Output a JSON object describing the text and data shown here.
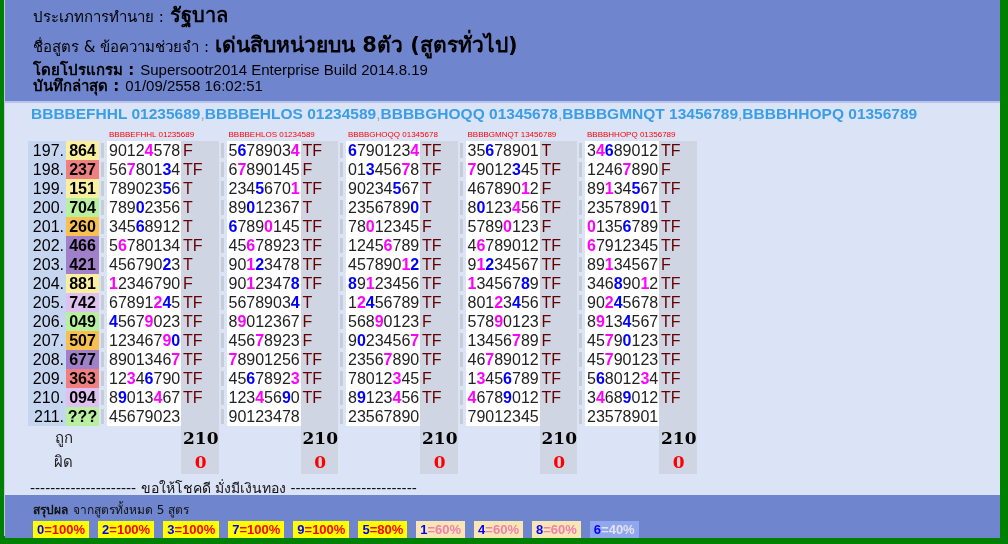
{
  "header": [
    {
      "label": "ประเภทการทำนาย :",
      "value": "รัฐบาล"
    },
    {
      "label": "ชื่อสูตร & ข้อความช่วยจำ :",
      "value": "เด่นสิบหน่วยบน 8ตัว (สูตรทั่วไป)"
    },
    {
      "label": "โดยโปรแกรม :",
      "value": "Supersootr2014 Enterprise Build 2014.8.19"
    },
    {
      "label": "บันทึกล่าสุด :",
      "value": "01/09/2558 16:02:51"
    }
  ],
  "formula_bar": {
    "separator": ",",
    "titles": [
      "BBBBEFHHL 01235689",
      "BBBBEHLOS 01234589",
      "BBBBGHOQQ 01345678",
      "BBBBGMNQT 13456789",
      "BBBBHHOPQ 01356789"
    ]
  },
  "rows": [
    {
      "number": "197.",
      "draw": "864",
      "color": "#f8f0a0"
    },
    {
      "number": "198.",
      "draw": "237",
      "color": "#f08080"
    },
    {
      "number": "199.",
      "draw": "151",
      "color": "#f8f0a0"
    },
    {
      "number": "200.",
      "draw": "704",
      "color": "#b8f0a0"
    },
    {
      "number": "201.",
      "draw": "260",
      "color": "#f8c050"
    },
    {
      "number": "202.",
      "draw": "466",
      "color": "#a080c8"
    },
    {
      "number": "203.",
      "draw": "421",
      "color": "#a080c8"
    },
    {
      "number": "204.",
      "draw": "881",
      "color": "#f8f0a0"
    },
    {
      "number": "205.",
      "draw": "742",
      "color": "#e0c0f0"
    },
    {
      "number": "206.",
      "draw": "049",
      "color": "#b8f0a0"
    },
    {
      "number": "207.",
      "draw": "507",
      "color": "#f8c050"
    },
    {
      "number": "208.",
      "draw": "677",
      "color": "#a080c8"
    },
    {
      "number": "209.",
      "draw": "363",
      "color": "#f08080"
    },
    {
      "number": "210.",
      "draw": "094",
      "color": "#e0c0f0"
    },
    {
      "number": "211.",
      "draw": "???",
      "color": "#b8f0a0"
    }
  ],
  "formulas": [
    {
      "label": "BBBBEFHHL 01235689",
      "correct": "210",
      "wrong": "0",
      "cells": [
        {
          "parts": [
            {
              "text": "9012"
            },
            {
              "text": "4",
              "color": "#ff00ff"
            },
            {
              "text": "578"
            }
          ],
          "result": "F"
        },
        {
          "parts": [
            {
              "text": "56"
            },
            {
              "text": "7",
              "color": "#ff00ff"
            },
            {
              "text": "801"
            },
            {
              "text": "3",
              "color": "#0000ff"
            },
            {
              "text": "4"
            }
          ],
          "result": "TF"
        },
        {
          "parts": [
            {
              "text": "789023"
            },
            {
              "text": "5",
              "color": "#0000ff"
            },
            {
              "text": "6"
            }
          ],
          "result": "T"
        },
        {
          "parts": [
            {
              "text": "789"
            },
            {
              "text": "0",
              "color": "#0000ff"
            },
            {
              "text": "2356"
            }
          ],
          "result": "T"
        },
        {
          "parts": [
            {
              "text": "345"
            },
            {
              "text": "6",
              "color": "#0000ff"
            },
            {
              "text": "8912"
            }
          ],
          "result": "T"
        },
        {
          "parts": [
            {
              "text": "5"
            },
            {
              "text": "6",
              "color": "#ff00ff"
            },
            {
              "text": "780134"
            }
          ],
          "result": "TF"
        },
        {
          "parts": [
            {
              "text": "456790"
            },
            {
              "text": "2",
              "color": "#0000ff"
            },
            {
              "text": "3"
            }
          ],
          "result": "T"
        },
        {
          "parts": [
            {
              "text": "1",
              "color": "#ff00ff"
            },
            {
              "text": "2346790"
            }
          ],
          "result": "F"
        },
        {
          "parts": [
            {
              "text": "67891"
            },
            {
              "text": "2",
              "color": "#ff00ff"
            },
            {
              "text": "4",
              "color": "#0000ff"
            },
            {
              "text": "5"
            }
          ],
          "result": "TF"
        },
        {
          "parts": [
            {
              "text": "4",
              "color": "#0000ff"
            },
            {
              "text": "567"
            },
            {
              "text": "9",
              "color": "#ff00ff"
            },
            {
              "text": "023"
            }
          ],
          "result": "TF"
        },
        {
          "parts": [
            {
              "text": "123467"
            },
            {
              "text": "9",
              "color": "#ff00ff"
            },
            {
              "text": "0",
              "color": "#0000ff"
            }
          ],
          "result": "TF"
        },
        {
          "parts": [
            {
              "text": "8901346"
            },
            {
              "text": "7",
              "color": "#ff00ff"
            }
          ],
          "result": "TF"
        },
        {
          "parts": [
            {
              "text": "12"
            },
            {
              "text": "3",
              "color": "#ff00ff"
            },
            {
              "text": "4"
            },
            {
              "text": "6",
              "color": "#0000ff"
            },
            {
              "text": "790"
            }
          ],
          "result": "TF"
        },
        {
          "parts": [
            {
              "text": "8"
            },
            {
              "text": "9",
              "color": "#0000ff"
            },
            {
              "text": "013"
            },
            {
              "text": "4",
              "color": "#ff00ff"
            },
            {
              "text": "67"
            }
          ],
          "result": "TF"
        },
        {
          "parts": [
            {
              "text": "45679023"
            }
          ]
        }
      ]
    },
    {
      "label": "BBBBEHLOS 01234589",
      "correct": "210",
      "wrong": "0",
      "cells": [
        {
          "parts": [
            {
              "text": "5"
            },
            {
              "text": "6",
              "color": "#0000ff"
            },
            {
              "text": "78903"
            },
            {
              "text": "4",
              "color": "#ff00ff"
            }
          ],
          "result": "TF"
        },
        {
          "parts": [
            {
              "text": "6"
            },
            {
              "text": "7",
              "color": "#ff00ff"
            },
            {
              "text": "890145"
            }
          ],
          "result": "F"
        },
        {
          "parts": [
            {
              "text": "234"
            },
            {
              "text": "5",
              "color": "#0000ff"
            },
            {
              "text": "670"
            },
            {
              "text": "1",
              "color": "#ff00ff"
            }
          ],
          "result": "TF"
        },
        {
          "parts": [
            {
              "text": "89"
            },
            {
              "text": "0",
              "color": "#0000ff"
            },
            {
              "text": "12367"
            }
          ],
          "result": "T"
        },
        {
          "parts": [
            {
              "text": "6",
              "color": "#0000ff"
            },
            {
              "text": "789"
            },
            {
              "text": "0",
              "color": "#ff00ff"
            },
            {
              "text": "145"
            }
          ],
          "result": "TF"
        },
        {
          "parts": [
            {
              "text": "45"
            },
            {
              "text": "6",
              "color": "#ff00ff"
            },
            {
              "text": "78923"
            }
          ],
          "result": "TF"
        },
        {
          "parts": [
            {
              "text": "90"
            },
            {
              "text": "1",
              "color": "#ff00ff"
            },
            {
              "text": "2",
              "color": "#0000ff"
            },
            {
              "text": "3478"
            }
          ],
          "result": "TF"
        },
        {
          "parts": [
            {
              "text": "90"
            },
            {
              "text": "1",
              "color": "#ff00ff"
            },
            {
              "text": "2347"
            },
            {
              "text": "8",
              "color": "#0000ff"
            }
          ],
          "result": "TF"
        },
        {
          "parts": [
            {
              "text": "5678903"
            },
            {
              "text": "4",
              "color": "#0000ff"
            }
          ],
          "result": "T"
        },
        {
          "parts": [
            {
              "text": "8"
            },
            {
              "text": "9",
              "color": "#ff00ff"
            },
            {
              "text": "012367"
            }
          ],
          "result": "F"
        },
        {
          "parts": [
            {
              "text": "456"
            },
            {
              "text": "7",
              "color": "#ff00ff"
            },
            {
              "text": "8923"
            }
          ],
          "result": "F"
        },
        {
          "parts": [
            {
              "text": "7",
              "color": "#ff00ff"
            },
            {
              "text": "8901256"
            }
          ],
          "result": "TF"
        },
        {
          "parts": [
            {
              "text": "45"
            },
            {
              "text": "6",
              "color": "#0000ff"
            },
            {
              "text": "7892"
            },
            {
              "text": "3",
              "color": "#ff00ff"
            }
          ],
          "result": "TF"
        },
        {
          "parts": [
            {
              "text": "123"
            },
            {
              "text": "4",
              "color": "#ff00ff"
            },
            {
              "text": "56"
            },
            {
              "text": "9",
              "color": "#0000ff"
            },
            {
              "text": "0"
            }
          ],
          "result": "TF"
        },
        {
          "parts": [
            {
              "text": "90123478"
            }
          ]
        }
      ]
    },
    {
      "label": "BBBBGHOQQ 01345678",
      "correct": "210",
      "wrong": "0",
      "cells": [
        {
          "parts": [
            {
              "text": "6",
              "color": "#0000ff"
            },
            {
              "text": "790123"
            },
            {
              "text": "4",
              "color": "#ff00ff"
            }
          ],
          "result": "TF"
        },
        {
          "parts": [
            {
              "text": "01"
            },
            {
              "text": "3",
              "color": "#0000ff"
            },
            {
              "text": "456"
            },
            {
              "text": "7",
              "color": "#ff00ff"
            },
            {
              "text": "8"
            }
          ],
          "result": "TF"
        },
        {
          "parts": [
            {
              "text": "90234"
            },
            {
              "text": "5",
              "color": "#0000ff"
            },
            {
              "text": "67"
            }
          ],
          "result": "T"
        },
        {
          "parts": [
            {
              "text": "2356789"
            },
            {
              "text": "0",
              "color": "#0000ff"
            }
          ],
          "result": "T"
        },
        {
          "parts": [
            {
              "text": "78"
            },
            {
              "text": "0",
              "color": "#ff00ff"
            },
            {
              "text": "12345"
            }
          ],
          "result": "F"
        },
        {
          "parts": [
            {
              "text": "1245"
            },
            {
              "text": "6",
              "color": "#ff00ff"
            },
            {
              "text": "789"
            }
          ],
          "result": "TF"
        },
        {
          "parts": [
            {
              "text": "457890"
            },
            {
              "text": "1",
              "color": "#ff00ff"
            },
            {
              "text": "2",
              "color": "#0000ff"
            }
          ],
          "result": "TF"
        },
        {
          "parts": [
            {
              "text": "8",
              "color": "#0000ff"
            },
            {
              "text": "9"
            },
            {
              "text": "1",
              "color": "#ff00ff"
            },
            {
              "text": "23456"
            }
          ],
          "result": "TF"
        },
        {
          "parts": [
            {
              "text": "1"
            },
            {
              "text": "2",
              "color": "#ff00ff"
            },
            {
              "text": "4",
              "color": "#0000ff"
            },
            {
              "text": "56789"
            }
          ],
          "result": "TF"
        },
        {
          "parts": [
            {
              "text": "568"
            },
            {
              "text": "9",
              "color": "#ff00ff"
            },
            {
              "text": "0123"
            }
          ],
          "result": "F"
        },
        {
          "parts": [
            {
              "text": "9"
            },
            {
              "text": "0",
              "color": "#0000ff"
            },
            {
              "text": "23456"
            },
            {
              "text": "7",
              "color": "#ff00ff"
            }
          ],
          "result": "TF"
        },
        {
          "parts": [
            {
              "text": "2356"
            },
            {
              "text": "7",
              "color": "#ff00ff"
            },
            {
              "text": "890"
            }
          ],
          "result": "TF"
        },
        {
          "parts": [
            {
              "text": "78012"
            },
            {
              "text": "3",
              "color": "#ff00ff"
            },
            {
              "text": "45"
            }
          ],
          "result": "F"
        },
        {
          "parts": [
            {
              "text": "8"
            },
            {
              "text": "9",
              "color": "#0000ff"
            },
            {
              "text": "123"
            },
            {
              "text": "4",
              "color": "#ff00ff"
            },
            {
              "text": "56"
            }
          ],
          "result": "TF"
        },
        {
          "parts": [
            {
              "text": "23567890"
            }
          ]
        }
      ]
    },
    {
      "label": "BBBBGMNQT 13456789",
      "correct": "210",
      "wrong": "0",
      "cells": [
        {
          "parts": [
            {
              "text": "35"
            },
            {
              "text": "6",
              "color": "#0000ff"
            },
            {
              "text": "78901"
            }
          ],
          "result": "T"
        },
        {
          "parts": [
            {
              "text": "7",
              "color": "#ff00ff"
            },
            {
              "text": "9012"
            },
            {
              "text": "3",
              "color": "#0000ff"
            },
            {
              "text": "45"
            }
          ],
          "result": "TF"
        },
        {
          "parts": [
            {
              "text": "467890"
            },
            {
              "text": "1",
              "color": "#ff00ff"
            },
            {
              "text": "2"
            }
          ],
          "result": "F"
        },
        {
          "parts": [
            {
              "text": "8"
            },
            {
              "text": "0",
              "color": "#0000ff"
            },
            {
              "text": "123"
            },
            {
              "text": "4",
              "color": "#ff00ff"
            },
            {
              "text": "56"
            }
          ],
          "result": "TF"
        },
        {
          "parts": [
            {
              "text": "5789"
            },
            {
              "text": "0",
              "color": "#ff00ff"
            },
            {
              "text": "123"
            }
          ],
          "result": "F"
        },
        {
          "parts": [
            {
              "text": "4"
            },
            {
              "text": "6",
              "color": "#ff00ff"
            },
            {
              "text": "789012"
            }
          ],
          "result": "TF"
        },
        {
          "parts": [
            {
              "text": "9"
            },
            {
              "text": "1",
              "color": "#ff00ff"
            },
            {
              "text": "2",
              "color": "#0000ff"
            },
            {
              "text": "34567"
            }
          ],
          "result": "TF"
        },
        {
          "parts": [
            {
              "text": "1",
              "color": "#ff00ff"
            },
            {
              "text": "34567"
            },
            {
              "text": "8",
              "color": "#0000ff"
            },
            {
              "text": "9"
            }
          ],
          "result": "TF"
        },
        {
          "parts": [
            {
              "text": "801"
            },
            {
              "text": "2",
              "color": "#ff00ff"
            },
            {
              "text": "3"
            },
            {
              "text": "4",
              "color": "#0000ff"
            },
            {
              "text": "56"
            }
          ],
          "result": "TF"
        },
        {
          "parts": [
            {
              "text": "578"
            },
            {
              "text": "9",
              "color": "#ff00ff"
            },
            {
              "text": "0123"
            }
          ],
          "result": "F"
        },
        {
          "parts": [
            {
              "text": "13456"
            },
            {
              "text": "7",
              "color": "#ff00ff"
            },
            {
              "text": "89"
            }
          ],
          "result": "F"
        },
        {
          "parts": [
            {
              "text": "46"
            },
            {
              "text": "7",
              "color": "#ff00ff"
            },
            {
              "text": "89012"
            }
          ],
          "result": "TF"
        },
        {
          "parts": [
            {
              "text": "1"
            },
            {
              "text": "3",
              "color": "#ff00ff"
            },
            {
              "text": "45"
            },
            {
              "text": "6",
              "color": "#0000ff"
            },
            {
              "text": "789"
            }
          ],
          "result": "TF"
        },
        {
          "parts": [
            {
              "text": "4",
              "color": "#ff00ff"
            },
            {
              "text": "678"
            },
            {
              "text": "9",
              "color": "#0000ff"
            },
            {
              "text": "012"
            }
          ],
          "result": "TF"
        },
        {
          "parts": [
            {
              "text": "79012345"
            }
          ]
        }
      ]
    },
    {
      "label": "BBBBHHOPQ 01356789",
      "correct": "210",
      "wrong": "0",
      "cells": [
        {
          "parts": [
            {
              "text": "3"
            },
            {
              "text": "4",
              "color": "#ff00ff"
            },
            {
              "text": "6",
              "color": "#0000ff"
            },
            {
              "text": "89012"
            }
          ],
          "result": "TF"
        },
        {
          "parts": [
            {
              "text": "1246"
            },
            {
              "text": "7",
              "color": "#ff00ff"
            },
            {
              "text": "890"
            }
          ],
          "result": "F"
        },
        {
          "parts": [
            {
              "text": "89"
            },
            {
              "text": "1",
              "color": "#ff00ff"
            },
            {
              "text": "34"
            },
            {
              "text": "5",
              "color": "#0000ff"
            },
            {
              "text": "67"
            }
          ],
          "result": "TF"
        },
        {
          "parts": [
            {
              "text": "235789"
            },
            {
              "text": "0",
              "color": "#0000ff"
            },
            {
              "text": "1"
            }
          ],
          "result": "T"
        },
        {
          "parts": [
            {
              "text": "0",
              "color": "#ff00ff"
            },
            {
              "text": "135"
            },
            {
              "text": "6",
              "color": "#0000ff"
            },
            {
              "text": "789"
            }
          ],
          "result": "TF"
        },
        {
          "parts": [
            {
              "text": "6",
              "color": "#ff00ff"
            },
            {
              "text": "7912345"
            }
          ],
          "result": "TF"
        },
        {
          "parts": [
            {
              "text": "89"
            },
            {
              "text": "1",
              "color": "#ff00ff"
            },
            {
              "text": "34567"
            }
          ],
          "result": "F"
        },
        {
          "parts": [
            {
              "text": "346"
            },
            {
              "text": "8",
              "color": "#0000ff"
            },
            {
              "text": "90"
            },
            {
              "text": "1",
              "color": "#ff00ff"
            },
            {
              "text": "2"
            }
          ],
          "result": "TF"
        },
        {
          "parts": [
            {
              "text": "90"
            },
            {
              "text": "2",
              "color": "#ff00ff"
            },
            {
              "text": "4",
              "color": "#0000ff"
            },
            {
              "text": "5678"
            }
          ],
          "result": "TF"
        },
        {
          "parts": [
            {
              "text": "8"
            },
            {
              "text": "9",
              "color": "#ff00ff"
            },
            {
              "text": "13"
            },
            {
              "text": "4",
              "color": "#0000ff"
            },
            {
              "text": "567"
            }
          ],
          "result": "TF"
        },
        {
          "parts": [
            {
              "text": "45"
            },
            {
              "text": "7",
              "color": "#ff00ff"
            },
            {
              "text": "9"
            },
            {
              "text": "0",
              "color": "#0000ff"
            },
            {
              "text": "123"
            }
          ],
          "result": "TF"
        },
        {
          "parts": [
            {
              "text": "45"
            },
            {
              "text": "7",
              "color": "#ff00ff"
            },
            {
              "text": "90123"
            }
          ],
          "result": "TF"
        },
        {
          "parts": [
            {
              "text": "5"
            },
            {
              "text": "6",
              "color": "#0000ff"
            },
            {
              "text": "8012"
            },
            {
              "text": "3",
              "color": "#ff00ff"
            },
            {
              "text": "4"
            }
          ],
          "result": "TF"
        },
        {
          "parts": [
            {
              "text": "3"
            },
            {
              "text": "4",
              "color": "#ff00ff"
            },
            {
              "text": "68"
            },
            {
              "text": "9",
              "color": "#0000ff"
            },
            {
              "text": "012"
            }
          ],
          "result": "TF"
        },
        {
          "parts": [
            {
              "text": "23578901"
            }
          ]
        }
      ]
    }
  ],
  "totals": {
    "correct_label": "ถูก",
    "wrong_label": "ผิด"
  },
  "footer": "--------------------- ขอให้โชคดี มั่งมีเงินทอง -------------------------",
  "summary": {
    "title": "สรุปผล",
    "subtitle": "จากสูตรทั้งหมด 5 สูตร",
    "badges": [
      {
        "digit": "0",
        "value": "=100%",
        "kind": "strong"
      },
      {
        "digit": "2",
        "value": "=100%",
        "kind": "strong"
      },
      {
        "digit": "3",
        "value": "=100%",
        "kind": "strong"
      },
      {
        "digit": "7",
        "value": "=100%",
        "kind": "strong"
      },
      {
        "digit": "9",
        "value": "=100%",
        "kind": "strong"
      },
      {
        "digit": "5",
        "value": "=80%",
        "kind": "strong"
      },
      {
        "digit": "1",
        "value": "=60%",
        "kind": "medium"
      },
      {
        "digit": "4",
        "value": "=60%",
        "kind": "medium"
      },
      {
        "digit": "8",
        "value": "=60%",
        "kind": "medium"
      },
      {
        "digit": "6",
        "value": "=40%",
        "kind": "weak"
      }
    ]
  }
}
